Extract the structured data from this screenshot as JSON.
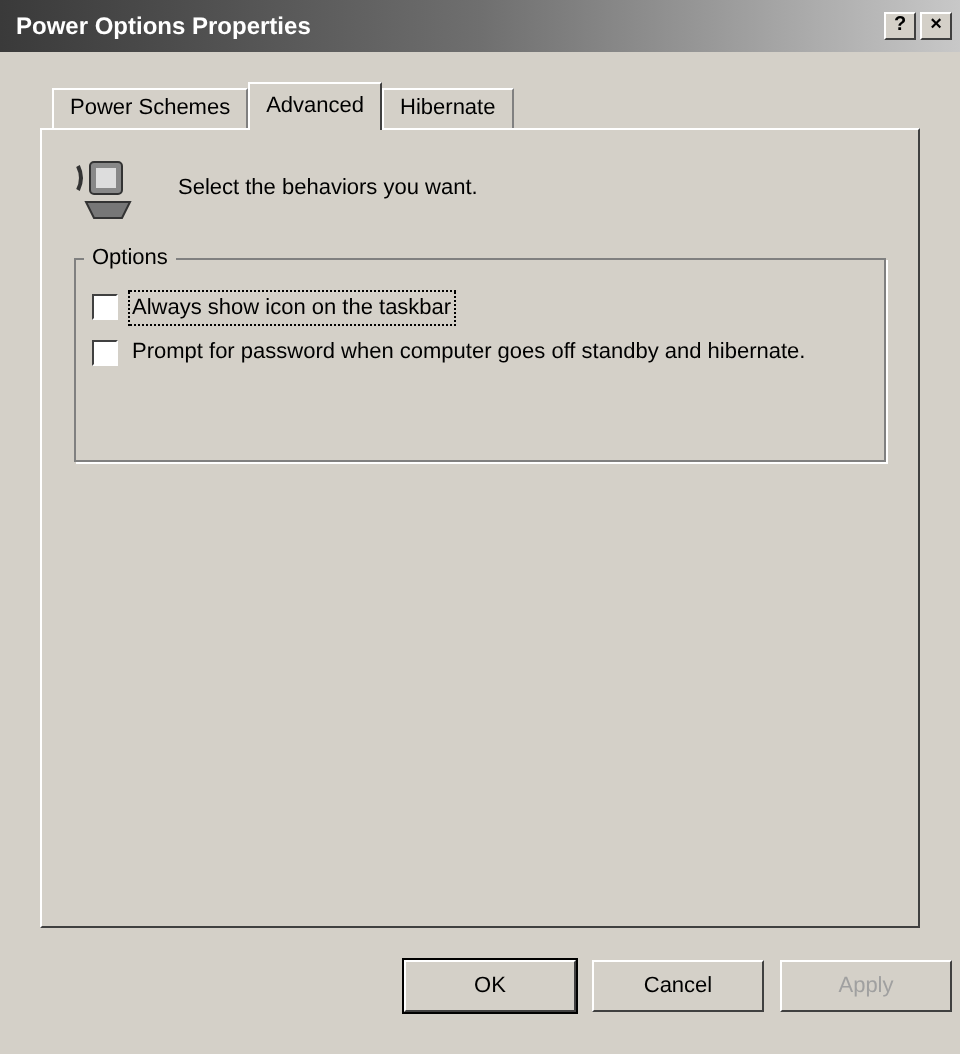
{
  "window": {
    "title": "Power Options Properties",
    "title_buttons": [
      "?",
      "×"
    ]
  },
  "tabs": [
    {
      "label": "Power Schemes",
      "selected": false
    },
    {
      "label": "Advanced",
      "selected": true
    },
    {
      "label": "Hibernate",
      "selected": false
    }
  ],
  "header": {
    "text": "Select the behaviors you want."
  },
  "options": {
    "title": "Options",
    "items": [
      {
        "label": "Always show icon on the taskbar",
        "checked": false,
        "focused": true
      },
      {
        "label": "Prompt for password when computer goes off standby and hibernate.",
        "checked": false,
        "focused": false
      }
    ]
  },
  "buttons": [
    {
      "label": "OK",
      "default": true,
      "disabled": false
    },
    {
      "label": "Cancel",
      "default": false,
      "disabled": false
    },
    {
      "label": "Apply",
      "default": false,
      "disabled": true
    }
  ]
}
